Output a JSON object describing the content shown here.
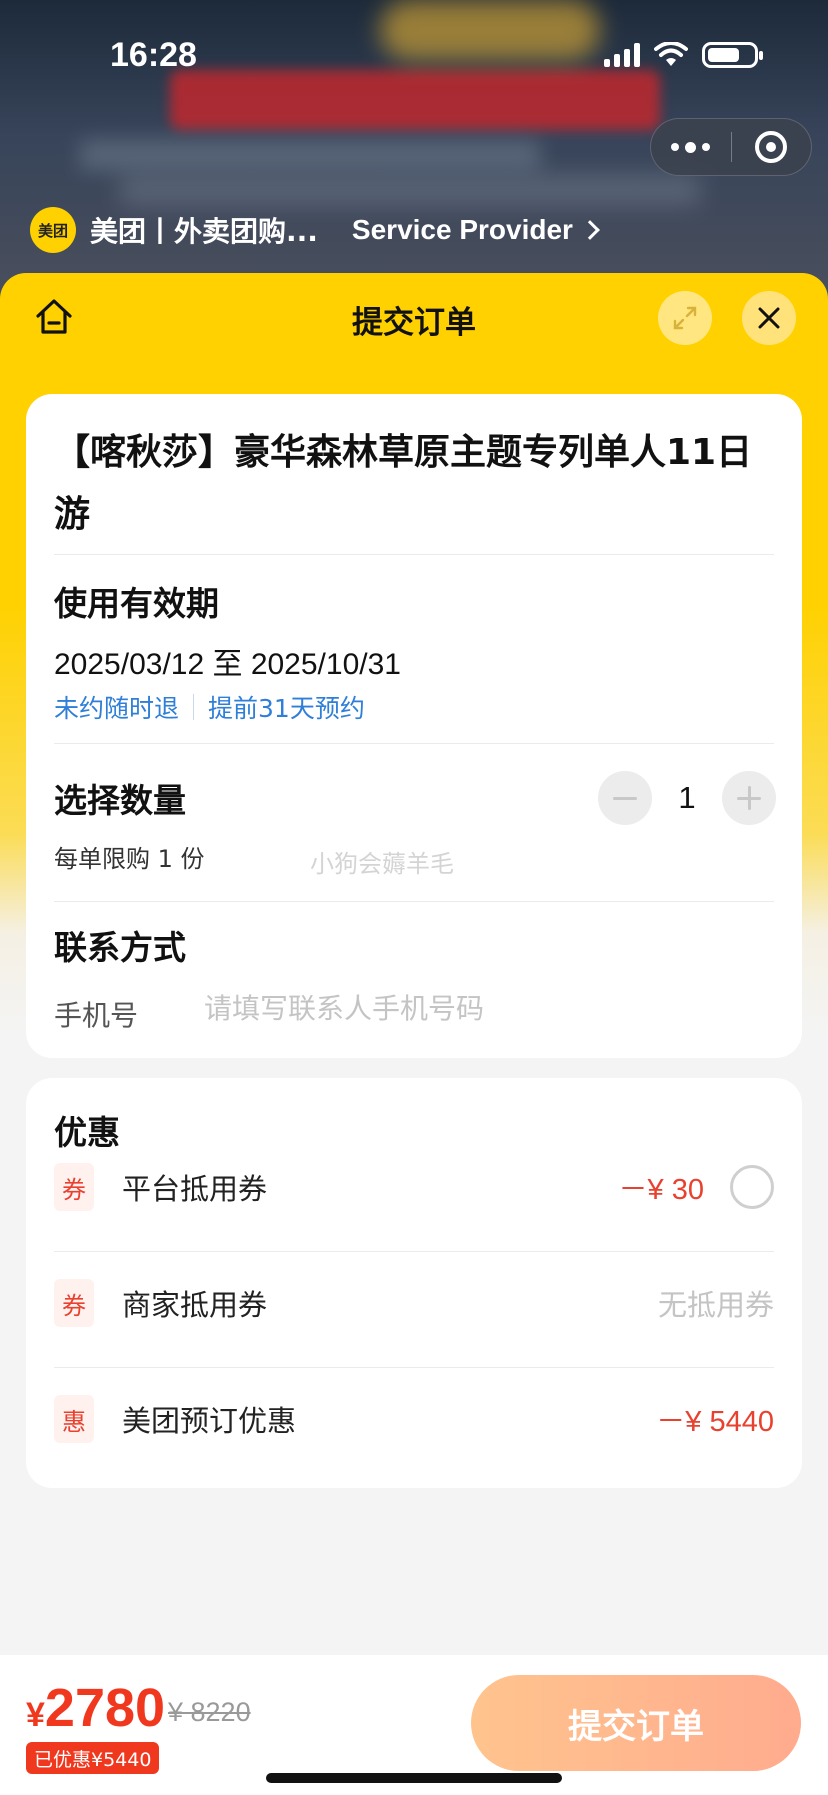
{
  "status_bar": {
    "time": "16:28"
  },
  "provider": {
    "logo_text": "美团",
    "name": "美团丨外卖团购...",
    "link_label": "Service Provider"
  },
  "header": {
    "title": "提交订单"
  },
  "product": {
    "title": "【喀秋莎】豪华森林草原主题专列单人11日游"
  },
  "validity": {
    "label": "使用有效期",
    "range": "2025/03/12 至 2025/10/31",
    "tags": [
      "未约随时退",
      "提前31天预约"
    ]
  },
  "quantity": {
    "label": "选择数量",
    "value": "1",
    "limit": "每单限购 1 份",
    "watermark": "小狗会薅羊毛"
  },
  "contact": {
    "label": "联系方式",
    "phone_label": "手机号",
    "phone_placeholder": "请填写联系人手机号码",
    "phone_value": ""
  },
  "promotions": {
    "title": "优惠",
    "items": [
      {
        "tag": "券",
        "name": "平台抵用券",
        "value": "－¥ 30",
        "selectable": true
      },
      {
        "tag": "券",
        "name": "商家抵用券",
        "value": "无抵用券",
        "selectable": false
      },
      {
        "tag": "惠",
        "name": "美团预订优惠",
        "value": "－¥ 5440",
        "selectable": false
      }
    ]
  },
  "footer": {
    "currency": "¥",
    "price": "2780",
    "original_price": "¥ 8220",
    "saved_text": "已优惠¥5440",
    "submit_label": "提交订单"
  },
  "colors": {
    "brand_yellow": "#ffd100",
    "price_red": "#f0381f",
    "link_blue": "#2f7fd8",
    "submit_gradient_start": "#ffc48e",
    "submit_gradient_end": "#ffab8e"
  }
}
